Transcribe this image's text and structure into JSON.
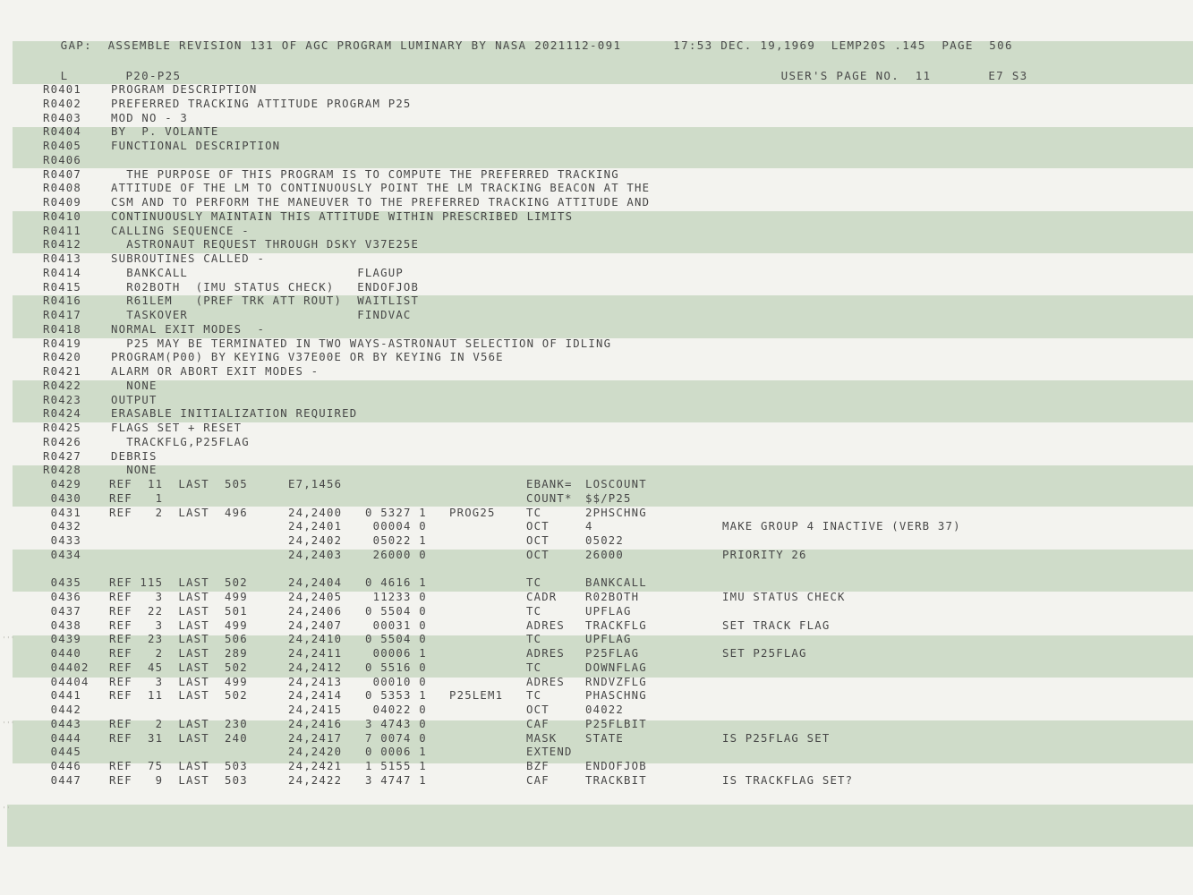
{
  "header": {
    "left": "GAP:  ASSEMBLE REVISION 131 OF AGC PROGRAM LUMINARY BY NASA 2021112-091",
    "right": "17:53 DEC. 19,1969  LEMP20S .145  PAGE  506"
  },
  "subheader": {
    "tag": "L",
    "section": "P20-P25",
    "user_page": "USER'S PAGE NO.  11",
    "code": "E7 S3"
  },
  "comment_lines": [
    {
      "no": "R0401",
      "text": "PROGRAM DESCRIPTION"
    },
    {
      "no": "R0402",
      "text": "PREFERRED TRACKING ATTITUDE PROGRAM P25"
    },
    {
      "no": "R0403",
      "text": "MOD NO - 3"
    },
    {
      "no": "R0404",
      "text": "BY  P. VOLANTE"
    },
    {
      "no": "R0405",
      "text": "FUNCTIONAL DESCRIPTION"
    },
    {
      "no": "R0406",
      "text": ""
    },
    {
      "no": "R0407",
      "text": "  THE PURPOSE OF THIS PROGRAM IS TO COMPUTE THE PREFERRED TRACKING"
    },
    {
      "no": "R0408",
      "text": "ATTITUDE OF THE LM TO CONTINUOUSLY POINT THE LM TRACKING BEACON AT THE"
    },
    {
      "no": "R0409",
      "text": "CSM AND TO PERFORM THE MANEUVER TO THE PREFERRED TRACKING ATTITUDE AND"
    },
    {
      "no": "R0410",
      "text": "CONTINUOUSLY MAINTAIN THIS ATTITUDE WITHIN PRESCRIBED LIMITS"
    },
    {
      "no": "R0411",
      "text": "CALLING SEQUENCE -"
    },
    {
      "no": "R0412",
      "text": "  ASTRONAUT REQUEST THROUGH DSKY V37E25E"
    },
    {
      "no": "R0413",
      "text": "SUBROUTINES CALLED -"
    },
    {
      "no": "R0414",
      "text": "  BANKCALL                      FLAGUP"
    },
    {
      "no": "R0415",
      "text": "  R02BOTH  (IMU STATUS CHECK)   ENDOFJOB"
    },
    {
      "no": "R0416",
      "text": "  R61LEM   (PREF TRK ATT ROUT)  WAITLIST"
    },
    {
      "no": "R0417",
      "text": "  TASKOVER                      FINDVAC"
    },
    {
      "no": "R0418",
      "text": "NORMAL EXIT MODES  -"
    },
    {
      "no": "R0419",
      "text": "  P25 MAY BE TERMINATED IN TWO WAYS-ASTRONAUT SELECTION OF IDLING"
    },
    {
      "no": "R0420",
      "text": "PROGRAM(P00) BY KEYING V37E00E OR BY KEYING IN V56E"
    },
    {
      "no": "R0421",
      "text": "ALARM OR ABORT EXIT MODES -"
    },
    {
      "no": "R0422",
      "text": "  NONE"
    },
    {
      "no": "R0423",
      "text": "OUTPUT"
    },
    {
      "no": "R0424",
      "text": "ERASABLE INITIALIZATION REQUIRED"
    },
    {
      "no": "R0425",
      "text": "FLAGS SET + RESET"
    },
    {
      "no": "R0426",
      "text": "  TRACKFLG,P25FLAG"
    },
    {
      "no": "R0427",
      "text": "DEBRIS"
    },
    {
      "no": "R0428",
      "text": "  NONE"
    }
  ],
  "code_lines": [
    {
      "no": " 0429",
      "ref": "REF  11  LAST  505",
      "addr": "E7,1456",
      "code": "",
      "label": "",
      "op": "EBANK=",
      "arg": "LOSCOUNT",
      "comment": ""
    },
    {
      "no": " 0430",
      "ref": "REF   1",
      "addr": "",
      "code": "",
      "label": "",
      "op": "COUNT*",
      "arg": "$$/P25",
      "comment": ""
    },
    {
      "no": " 0431",
      "ref": "REF   2  LAST  496",
      "addr": "24,2400",
      "code": "0 5327 1",
      "label": "PROG25",
      "op": "TC",
      "arg": "2PHSCHNG",
      "comment": ""
    },
    {
      "no": " 0432",
      "ref": "",
      "addr": "24,2401",
      "code": " 00004 0",
      "label": "",
      "op": "OCT",
      "arg": "4",
      "comment": "MAKE GROUP 4 INACTIVE (VERB 37)"
    },
    {
      "no": " 0433",
      "ref": "",
      "addr": "24,2402",
      "code": " 05022 1",
      "label": "",
      "op": "OCT",
      "arg": "05022",
      "comment": ""
    },
    {
      "no": " 0434",
      "ref": "",
      "addr": "24,2403",
      "code": " 26000 0",
      "label": "",
      "op": "OCT",
      "arg": "26000",
      "comment": "PRIORITY 26"
    },
    {
      "no": " 0435",
      "ref": "REF 115  LAST  502",
      "addr": "24,2404",
      "code": "0 4616 1",
      "label": "",
      "op": "TC",
      "arg": "BANKCALL",
      "comment": ""
    },
    {
      "no": " 0436",
      "ref": "REF   3  LAST  499",
      "addr": "24,2405",
      "code": " 11233 0",
      "label": "",
      "op": "CADR",
      "arg": "R02BOTH",
      "comment": "IMU STATUS CHECK"
    },
    {
      "no": " 0437",
      "ref": "REF  22  LAST  501",
      "addr": "24,2406",
      "code": "0 5504 0",
      "label": "",
      "op": "TC",
      "arg": "UPFLAG",
      "comment": ""
    },
    {
      "no": " 0438",
      "ref": "REF   3  LAST  499",
      "addr": "24,2407",
      "code": " 00031 0",
      "label": "",
      "op": "ADRES",
      "arg": "TRACKFLG",
      "comment": "SET TRACK FLAG"
    },
    {
      "no": " 0439",
      "ref": "REF  23  LAST  506",
      "addr": "24,2410",
      "code": "0 5504 0",
      "label": "",
      "op": "TC",
      "arg": "UPFLAG",
      "comment": ""
    },
    {
      "no": " 0440",
      "ref": "REF   2  LAST  289",
      "addr": "24,2411",
      "code": " 00006 1",
      "label": "",
      "op": "ADRES",
      "arg": "P25FLAG",
      "comment": "SET P25FLAG"
    },
    {
      "no": " 04402",
      "ref": "REF  45  LAST  502",
      "addr": "24,2412",
      "code": "0 5516 0",
      "label": "",
      "op": "TC",
      "arg": "DOWNFLAG",
      "comment": ""
    },
    {
      "no": " 04404",
      "ref": "REF   3  LAST  499",
      "addr": "24,2413",
      "code": " 00010 0",
      "label": "",
      "op": "ADRES",
      "arg": "RNDVZFLG",
      "comment": ""
    },
    {
      "no": " 0441",
      "ref": "REF  11  LAST  502",
      "addr": "24,2414",
      "code": "0 5353 1",
      "label": "P25LEM1",
      "op": "TC",
      "arg": "PHASCHNG",
      "comment": ""
    },
    {
      "no": " 0442",
      "ref": "",
      "addr": "24,2415",
      "code": " 04022 0",
      "label": "",
      "op": "OCT",
      "arg": "04022",
      "comment": ""
    },
    {
      "no": " 0443",
      "ref": "REF   2  LAST  230",
      "addr": "24,2416",
      "code": "3 4743 0",
      "label": "",
      "op": "CAF",
      "arg": "P25FLBIT",
      "comment": ""
    },
    {
      "no": " 0444",
      "ref": "REF  31  LAST  240",
      "addr": "24,2417",
      "code": "7 0074 0",
      "label": "",
      "op": "MASK",
      "arg": "STATE",
      "comment": "IS P25FLAG SET"
    },
    {
      "no": " 0445",
      "ref": "",
      "addr": "24,2420",
      "code": "0 0006 1",
      "label": "",
      "op": "EXTEND",
      "arg": "",
      "comment": ""
    },
    {
      "no": " 0446",
      "ref": "REF  75  LAST  503",
      "addr": "24,2421",
      "code": "1 5155 1",
      "label": "",
      "op": "BZF",
      "arg": "ENDOFJOB",
      "comment": ""
    },
    {
      "no": " 0447",
      "ref": "REF   9  LAST  503",
      "addr": "24,2422",
      "code": "3 4747 1",
      "label": "",
      "op": "CAF",
      "arg": "TRACKBIT",
      "comment": "IS TRACKFLAG SET?"
    }
  ]
}
